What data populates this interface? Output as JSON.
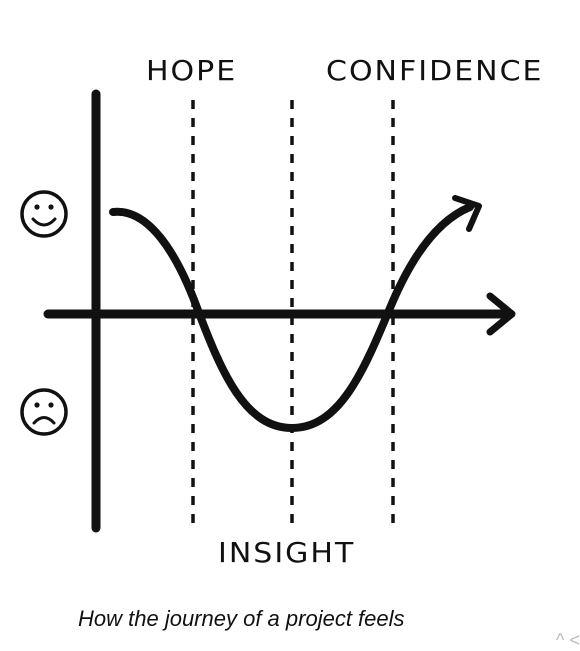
{
  "labels": {
    "hope": "HOPE",
    "confidence": "CONFIDENCE",
    "insight": "INSIGHT"
  },
  "icons": {
    "happy": "smiley-face-icon",
    "sad": "sad-face-icon"
  },
  "caption": "How the journey of a project feels",
  "corner_mark": "^ <"
}
